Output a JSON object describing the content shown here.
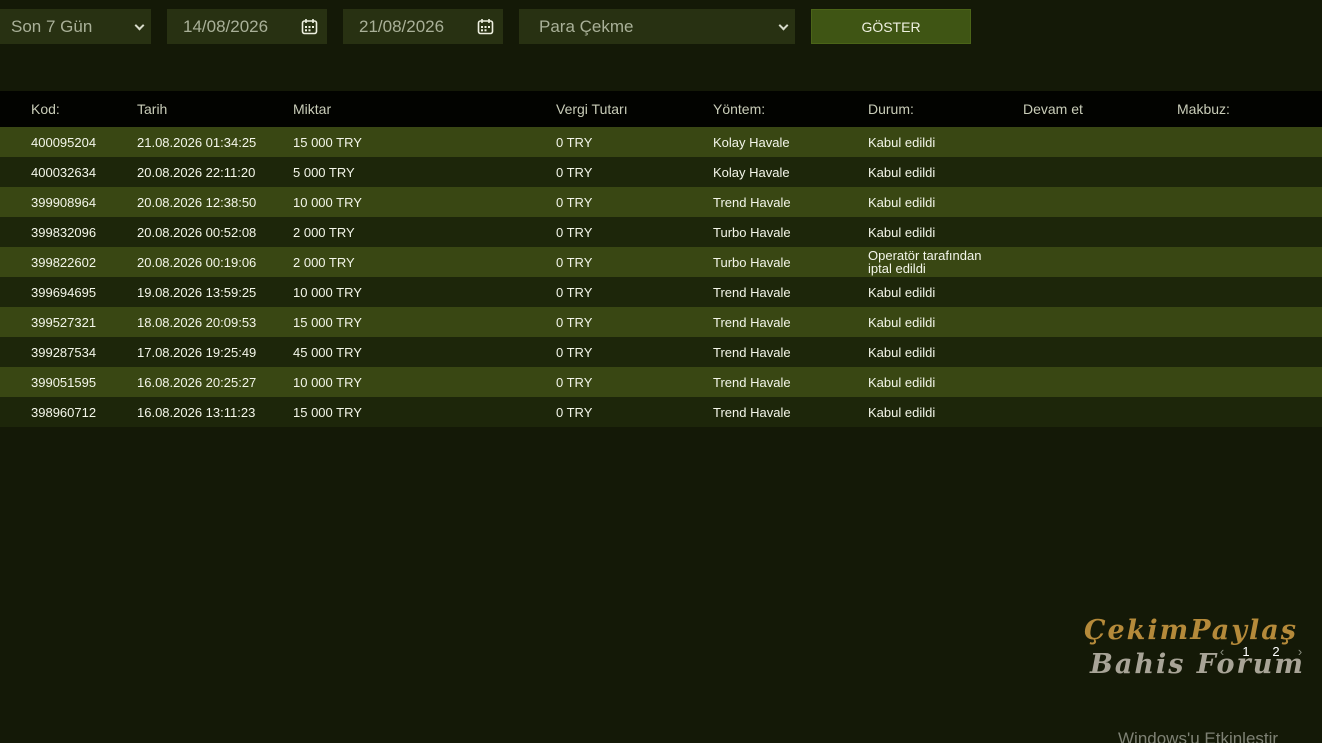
{
  "filters": {
    "period": "Son 7 Gün",
    "date_from": "14/08/2026",
    "date_to": "21/08/2026",
    "type": "Para Çekme",
    "show_label": "GÖSTER"
  },
  "table": {
    "headers": [
      "Kod:",
      "Tarih",
      "Miktar",
      "Vergi Tutarı",
      "Yöntem:",
      "Durum:",
      "Devam et",
      "Makbuz:"
    ],
    "rows": [
      {
        "kod": "400095204",
        "tarih": "21.08.2026 01:34:25",
        "miktar": "15 000 TRY",
        "vergi": "0 TRY",
        "yontem": "Kolay Havale",
        "durum": "Kabul edildi"
      },
      {
        "kod": "400032634",
        "tarih": "20.08.2026 22:11:20",
        "miktar": "5 000 TRY",
        "vergi": "0 TRY",
        "yontem": "Kolay Havale",
        "durum": "Kabul edildi"
      },
      {
        "kod": "399908964",
        "tarih": "20.08.2026 12:38:50",
        "miktar": "10 000 TRY",
        "vergi": "0 TRY",
        "yontem": "Trend Havale",
        "durum": "Kabul edildi"
      },
      {
        "kod": "399832096",
        "tarih": "20.08.2026 00:52:08",
        "miktar": "2 000 TRY",
        "vergi": "0 TRY",
        "yontem": "Turbo Havale",
        "durum": "Kabul edildi"
      },
      {
        "kod": "399822602",
        "tarih": "20.08.2026 00:19:06",
        "miktar": "2 000 TRY",
        "vergi": "0 TRY",
        "yontem": "Turbo Havale",
        "durum": "Operatör tarafından iptal edildi"
      },
      {
        "kod": "399694695",
        "tarih": "19.08.2026 13:59:25",
        "miktar": "10 000 TRY",
        "vergi": "0 TRY",
        "yontem": "Trend Havale",
        "durum": "Kabul edildi"
      },
      {
        "kod": "399527321",
        "tarih": "18.08.2026 20:09:53",
        "miktar": "15 000 TRY",
        "vergi": "0 TRY",
        "yontem": "Trend Havale",
        "durum": "Kabul edildi"
      },
      {
        "kod": "399287534",
        "tarih": "17.08.2026 19:25:49",
        "miktar": "45 000 TRY",
        "vergi": "0 TRY",
        "yontem": "Trend Havale",
        "durum": "Kabul edildi"
      },
      {
        "kod": "399051595",
        "tarih": "16.08.2026 20:25:27",
        "miktar": "10 000 TRY",
        "vergi": "0 TRY",
        "yontem": "Trend Havale",
        "durum": "Kabul edildi"
      },
      {
        "kod": "398960712",
        "tarih": "16.08.2026 13:11:23",
        "miktar": "15 000 TRY",
        "vergi": "0 TRY",
        "yontem": "Trend Havale",
        "durum": "Kabul edildi"
      }
    ]
  },
  "pagination": {
    "prev": "‹",
    "pages": [
      "1",
      "2"
    ],
    "next": "›"
  },
  "watermark": {
    "line1": "ÇekimPaylaş",
    "line2": "Bahis Forum"
  },
  "os_overlay": "Windows'u Etkinleştir",
  "colors": {
    "background": "#141907",
    "row_odd": "#394713",
    "row_even": "#1d260a",
    "button": "#3f5514",
    "header": "#020300"
  }
}
